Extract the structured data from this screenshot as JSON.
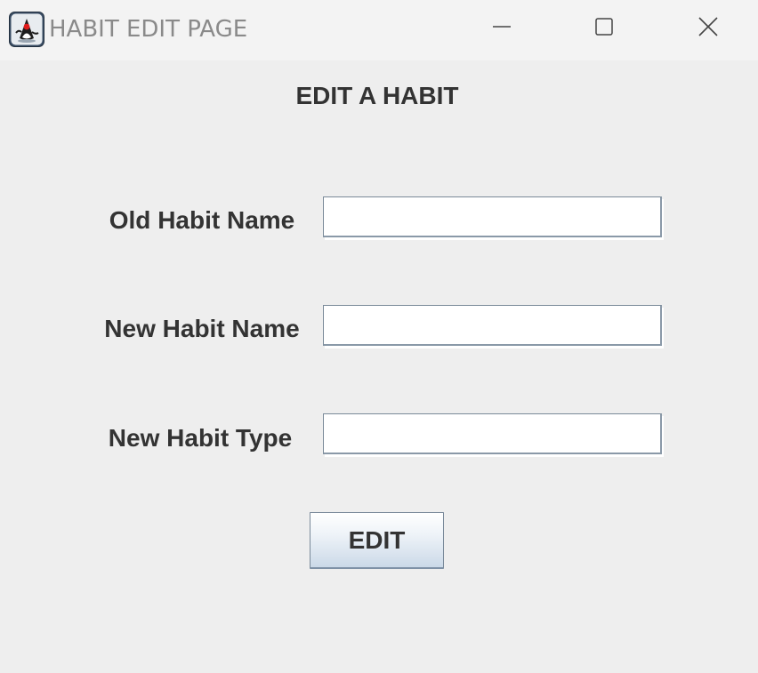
{
  "window": {
    "title": "HABIT EDIT PAGE",
    "app_icon": "java-duke-icon",
    "controls": {
      "minimize_icon": "minimize-icon",
      "maximize_icon": "maximize-icon",
      "close_icon": "close-icon"
    }
  },
  "form": {
    "heading": "EDIT A HABIT",
    "fields": [
      {
        "label": "Old Habit Name",
        "value": ""
      },
      {
        "label": "New Habit Name",
        "value": ""
      },
      {
        "label": "New Habit Type",
        "value": ""
      }
    ],
    "submit_label": "EDIT"
  },
  "colors": {
    "background": "#eeeeee",
    "titlebar": "#f3f3f3",
    "text": "#333333",
    "title_text": "#8a8a8a",
    "button_gradient_top": "#ffffff",
    "button_gradient_bottom": "#cbd9e8"
  }
}
